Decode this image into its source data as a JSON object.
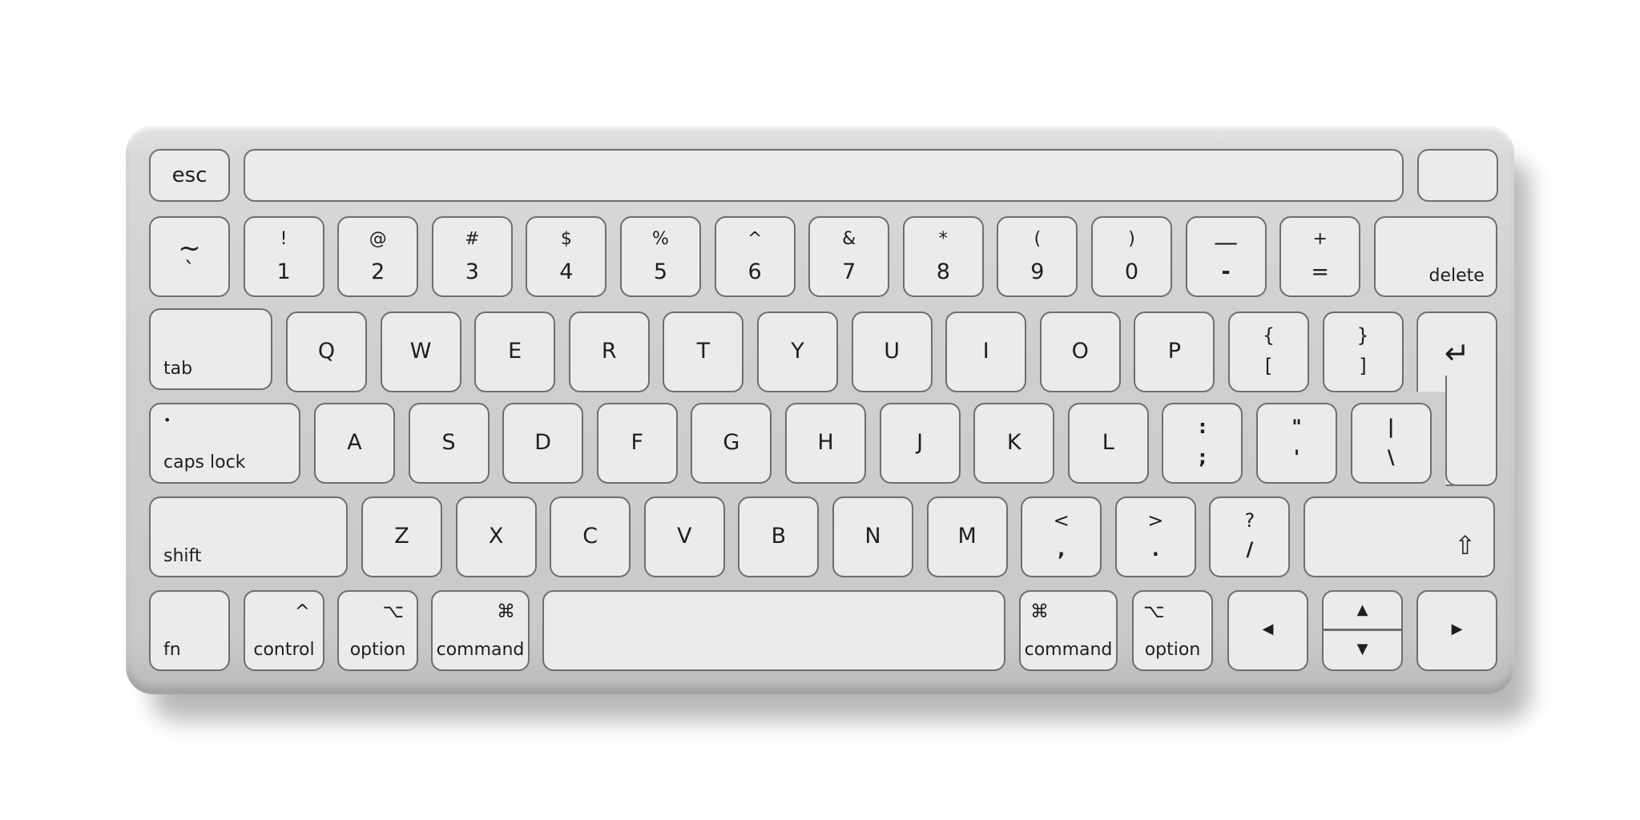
{
  "keyboard": {
    "row0": {
      "esc": "esc"
    },
    "row1": [
      {
        "top": "~",
        "bottom": "`"
      },
      {
        "top": "!",
        "bottom": "1"
      },
      {
        "top": "@",
        "bottom": "2"
      },
      {
        "top": "#",
        "bottom": "3"
      },
      {
        "top": "$",
        "bottom": "4"
      },
      {
        "top": "%",
        "bottom": "5"
      },
      {
        "top": "^",
        "bottom": "6"
      },
      {
        "top": "&",
        "bottom": "7"
      },
      {
        "top": "*",
        "bottom": "8"
      },
      {
        "top": "(",
        "bottom": "9"
      },
      {
        "top": ")",
        "bottom": "0"
      },
      {
        "top": "—",
        "bottom": "-"
      },
      {
        "top": "+",
        "bottom": "="
      }
    ],
    "delete": "delete",
    "tab": "tab",
    "row2": [
      "Q",
      "W",
      "E",
      "R",
      "T",
      "Y",
      "U",
      "I",
      "O",
      "P"
    ],
    "row2_sym": [
      {
        "top": "{",
        "bottom": "["
      },
      {
        "top": "}",
        "bottom": "]"
      }
    ],
    "return_icon": "↵",
    "caps_lock": "caps lock",
    "caps_dot": "•",
    "row3": [
      "A",
      "S",
      "D",
      "F",
      "G",
      "H",
      "J",
      "K",
      "L"
    ],
    "row3_sym": [
      {
        "top": ":",
        "bottom": ";"
      },
      {
        "top": "\"",
        "bottom": "'"
      },
      {
        "top": "|",
        "bottom": "\\"
      }
    ],
    "shift_left": "shift",
    "row4": [
      "Z",
      "X",
      "C",
      "V",
      "B",
      "N",
      "M"
    ],
    "row4_sym": [
      {
        "top": "<",
        "bottom": ","
      },
      {
        "top": ">",
        "bottom": "."
      },
      {
        "top": "?",
        "bottom": "/"
      }
    ],
    "shift_right_icon": "⇧",
    "fn": "fn",
    "control": {
      "label": "control",
      "symbol": "^"
    },
    "option_left": {
      "label": "option",
      "symbol": "⌥"
    },
    "command_left": {
      "label": "command",
      "symbol": "⌘"
    },
    "command_right": {
      "label": "command",
      "symbol": "⌘"
    },
    "option_right": {
      "label": "option",
      "symbol": "⌥"
    },
    "arrow_left": "◀",
    "arrow_up": "▲",
    "arrow_down": "▼",
    "arrow_right": "▶"
  }
}
